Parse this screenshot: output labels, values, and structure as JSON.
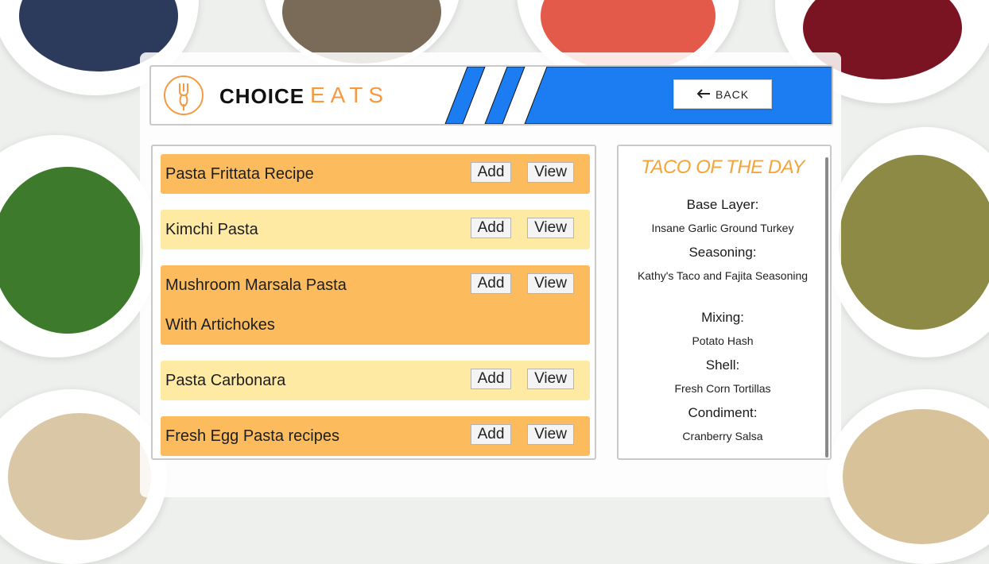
{
  "brand": {
    "choice": "CHOICE",
    "eats": "EATS"
  },
  "header": {
    "back_label": "BACK"
  },
  "recipes": [
    {
      "name": "Pasta Frittata Recipe",
      "name_line2": "",
      "add": "Add",
      "view": "View",
      "color": "#fcbc5e"
    },
    {
      "name": "Kimchi Pasta",
      "name_line2": "",
      "add": "Add",
      "view": "View",
      "color": "#feeaa3"
    },
    {
      "name": "Mushroom Marsala Pasta",
      "name_line2": "With Artichokes",
      "add": "Add",
      "view": "View",
      "color": "#fcbc5e"
    },
    {
      "name": "Pasta Carbonara",
      "name_line2": "",
      "add": "Add",
      "view": "View",
      "color": "#feeaa3"
    },
    {
      "name": "Fresh Egg Pasta recipes",
      "name_line2": "",
      "add": "Add",
      "view": "View",
      "color": "#fcbc5e"
    }
  ],
  "taco": {
    "title": "TACO OF THE DAY",
    "base_label": "Base Layer:",
    "base_value": "Insane Garlic Ground Turkey",
    "seasoning_label": "Seasoning:",
    "seasoning_value": "Kathy's Taco and Fajita Seasoning",
    "mixing_label": "Mixing:",
    "mixing_value": "Potato Hash",
    "shell_label": "Shell:",
    "shell_value": "Fresh Corn Tortillas",
    "condiment_label": "Condiment:",
    "condiment_value": "Cranberry Salsa"
  },
  "colors": {
    "accent_orange": "#f39a45",
    "header_blue": "#1c7cf2",
    "row_dark": "#fcbc5e",
    "row_light": "#feeaa3",
    "taco_title": "#f3a43a"
  },
  "icons": {
    "logo": "fork-spoon-logo-icon",
    "back": "arrow-left-icon"
  }
}
